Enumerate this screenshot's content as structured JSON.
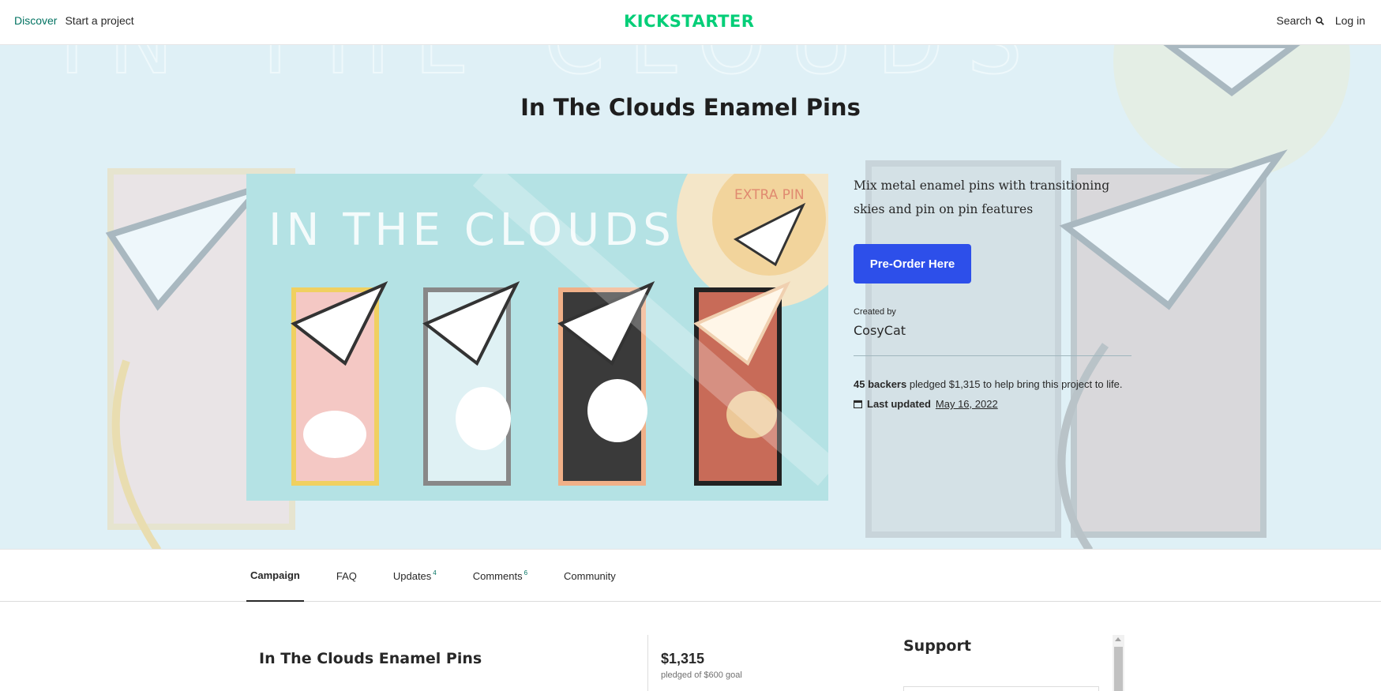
{
  "nav": {
    "discover": "Discover",
    "start": "Start a project",
    "logo": "KICKSTARTER",
    "search": "Search",
    "login": "Log in"
  },
  "hero": {
    "title": "In The Clouds Enamel Pins",
    "image_headline": "IN THE CLOUDS",
    "image_badge": "EXTRA PIN",
    "blurb": "Mix metal enamel pins with transitioning skies and pin on pin features",
    "cta": "Pre-Order Here",
    "created_by_label": "Created by",
    "creator": "CosyCat",
    "backers": "45 backers",
    "pledged_text": "pledged $1,315 to help bring this project to life.",
    "last_updated_label": "Last updated",
    "last_updated_date": "May 16, 2022"
  },
  "tabs": [
    {
      "label": "Campaign",
      "count": ""
    },
    {
      "label": "FAQ",
      "count": ""
    },
    {
      "label": "Updates",
      "count": "4"
    },
    {
      "label": "Comments",
      "count": "6"
    },
    {
      "label": "Community",
      "count": ""
    }
  ],
  "main": {
    "title": "In The Clouds Enamel Pins",
    "pledged_amount": "$1,315",
    "goal_text": "pledged of $600 goal",
    "support_heading": "Support"
  },
  "colors": {
    "brand": "#05ce78",
    "cta": "#2d4fea",
    "hero_bg": "#dff0f6"
  }
}
